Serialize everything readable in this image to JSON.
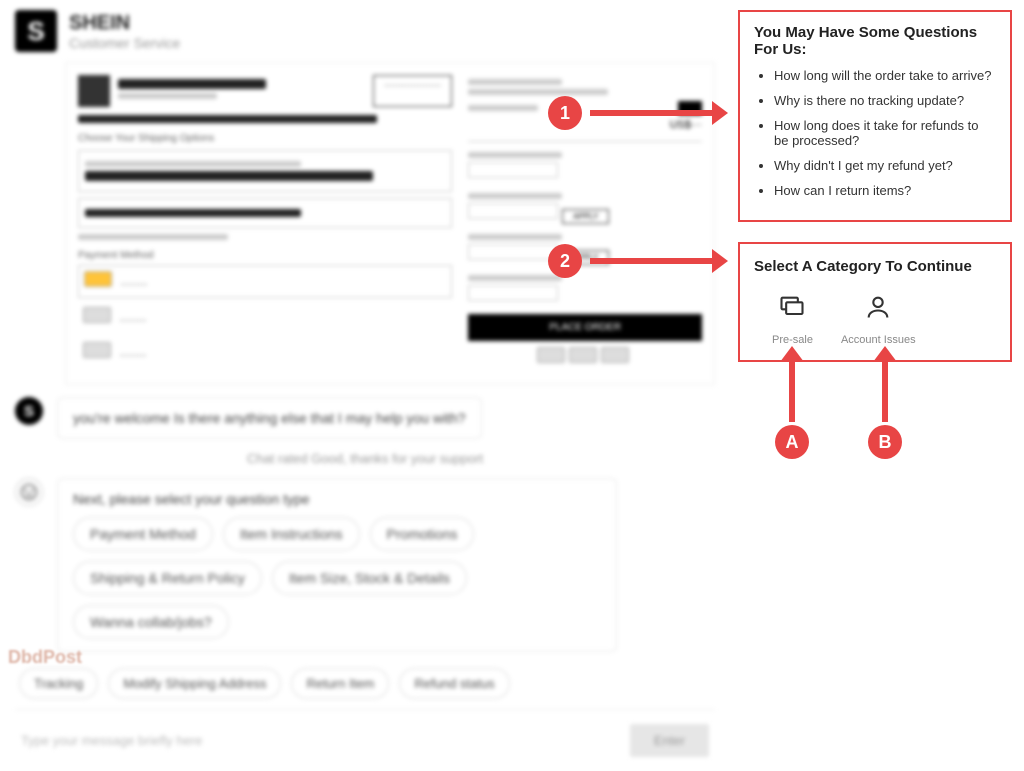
{
  "header": {
    "logo_letter": "S",
    "brand": "SHEIN",
    "subtitle": "Customer Service"
  },
  "checkout": {
    "shipping_title": "Choose Your Shipping Options",
    "payment_title": "Payment Method",
    "place_order": "PLACE ORDER",
    "apply": "APPLY"
  },
  "chat": {
    "agent_msg": "you're welcome Is there anything else that I may help you with?",
    "rating_msg": "Chat rated Good, thanks for your support",
    "bot_msg": "Next, please select your question type",
    "chips": [
      "Payment Method",
      "Item Instructions",
      "Promotions",
      "Shipping & Return Policy",
      "Item Size, Stock & Details",
      "Wanna collab/jobs?"
    ],
    "bottom_chips": [
      "Tracking",
      "Modify Shipping Address",
      "Return Item",
      "Refund status"
    ],
    "input_placeholder": "Type your message briefly here",
    "enter_label": "Enter"
  },
  "faq": {
    "title": "You May Have Some Questions For Us:",
    "items": [
      "How long will the order take to arrive?",
      "Why is there no tracking update?",
      "How long does it take for refunds to be processed?",
      "Why didn't I get my refund yet?",
      "How can I return items?"
    ]
  },
  "categories": {
    "title": "Select A Category To Continue",
    "items": [
      {
        "label": "Pre-sale"
      },
      {
        "label": "Account Issues"
      }
    ]
  },
  "annotations": {
    "circle1": "1",
    "circle2": "2",
    "circleA": "A",
    "circleB": "B"
  },
  "watermark": "DbdPost"
}
